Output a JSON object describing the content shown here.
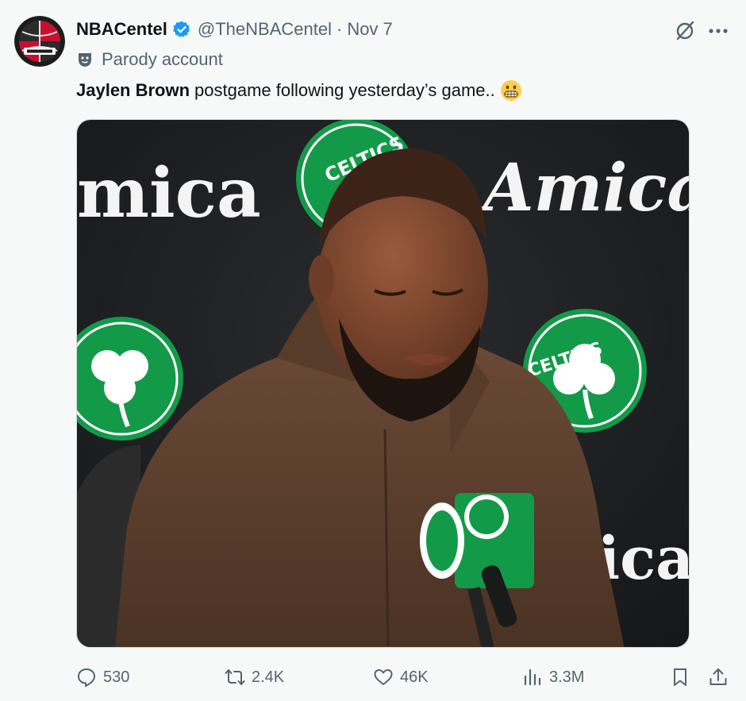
{
  "tweet": {
    "author_name": "NBACentel",
    "handle": "@TheNBACentel",
    "separator": "·",
    "timestamp": "Nov 7",
    "parody_label": "Parody account",
    "text_bold": "Jaylen Brown",
    "text_rest": "postgame following yesterday’s game..",
    "emoji": "grimacing-face-icon"
  },
  "media": {
    "backdrop_words": [
      "mica",
      "Amica",
      "ica"
    ],
    "logo_text": "CELTICS"
  },
  "actions": {
    "replies": "530",
    "reposts": "2.4K",
    "likes": "46K",
    "views": "3.3M"
  },
  "colors": {
    "verified_blue": "#1d9bf0",
    "secondary_text": "#536471",
    "celtics_green": "#139a48",
    "jacket_brown": "#5b3f2e"
  }
}
